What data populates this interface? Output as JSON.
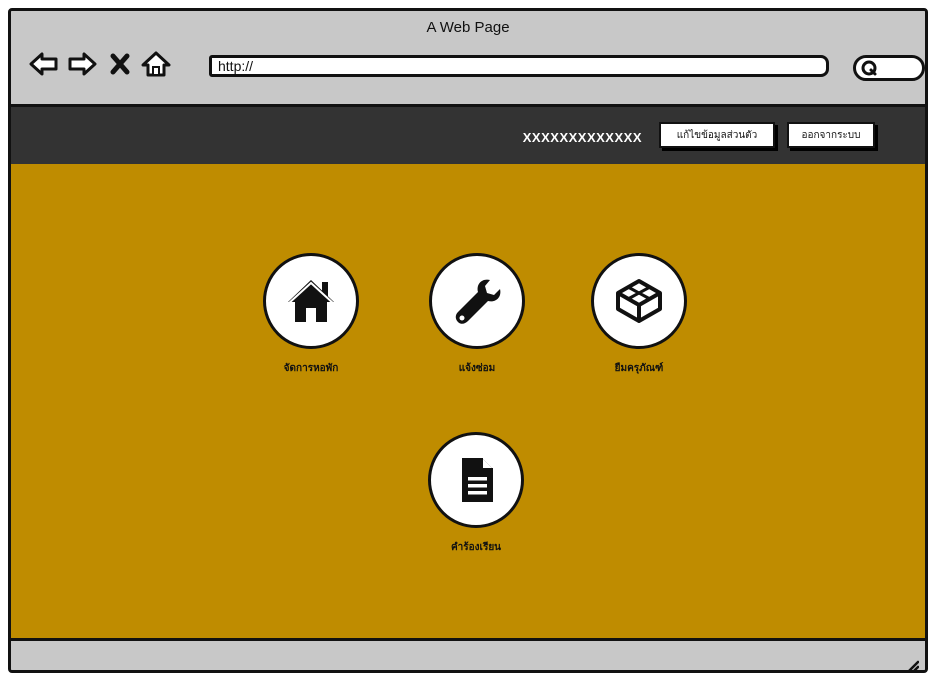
{
  "window": {
    "title": "A Web Page"
  },
  "toolbar": {
    "back_icon": "back-arrow-icon",
    "forward_icon": "forward-arrow-icon",
    "stop_icon": "close-icon",
    "home_icon": "home-outline-icon",
    "url": "http://",
    "search_icon": "search-icon"
  },
  "header": {
    "username": "XXXXXXXXXXXXX",
    "edit_profile_label": "แก้ไขข้อมูลส่วนตัว",
    "logout_label": "ออกจากระบบ",
    "background": "#333333"
  },
  "main": {
    "background": "#bf8c00",
    "tiles": [
      {
        "label": "จัดการหอพัก",
        "icon": "home-icon"
      },
      {
        "label": "แจ้งซ่อม",
        "icon": "wrench-icon"
      },
      {
        "label": "ยืมครุภัณฑ์",
        "icon": "box-icon"
      },
      {
        "label": "คำร้องเรียน",
        "icon": "document-icon"
      }
    ]
  }
}
